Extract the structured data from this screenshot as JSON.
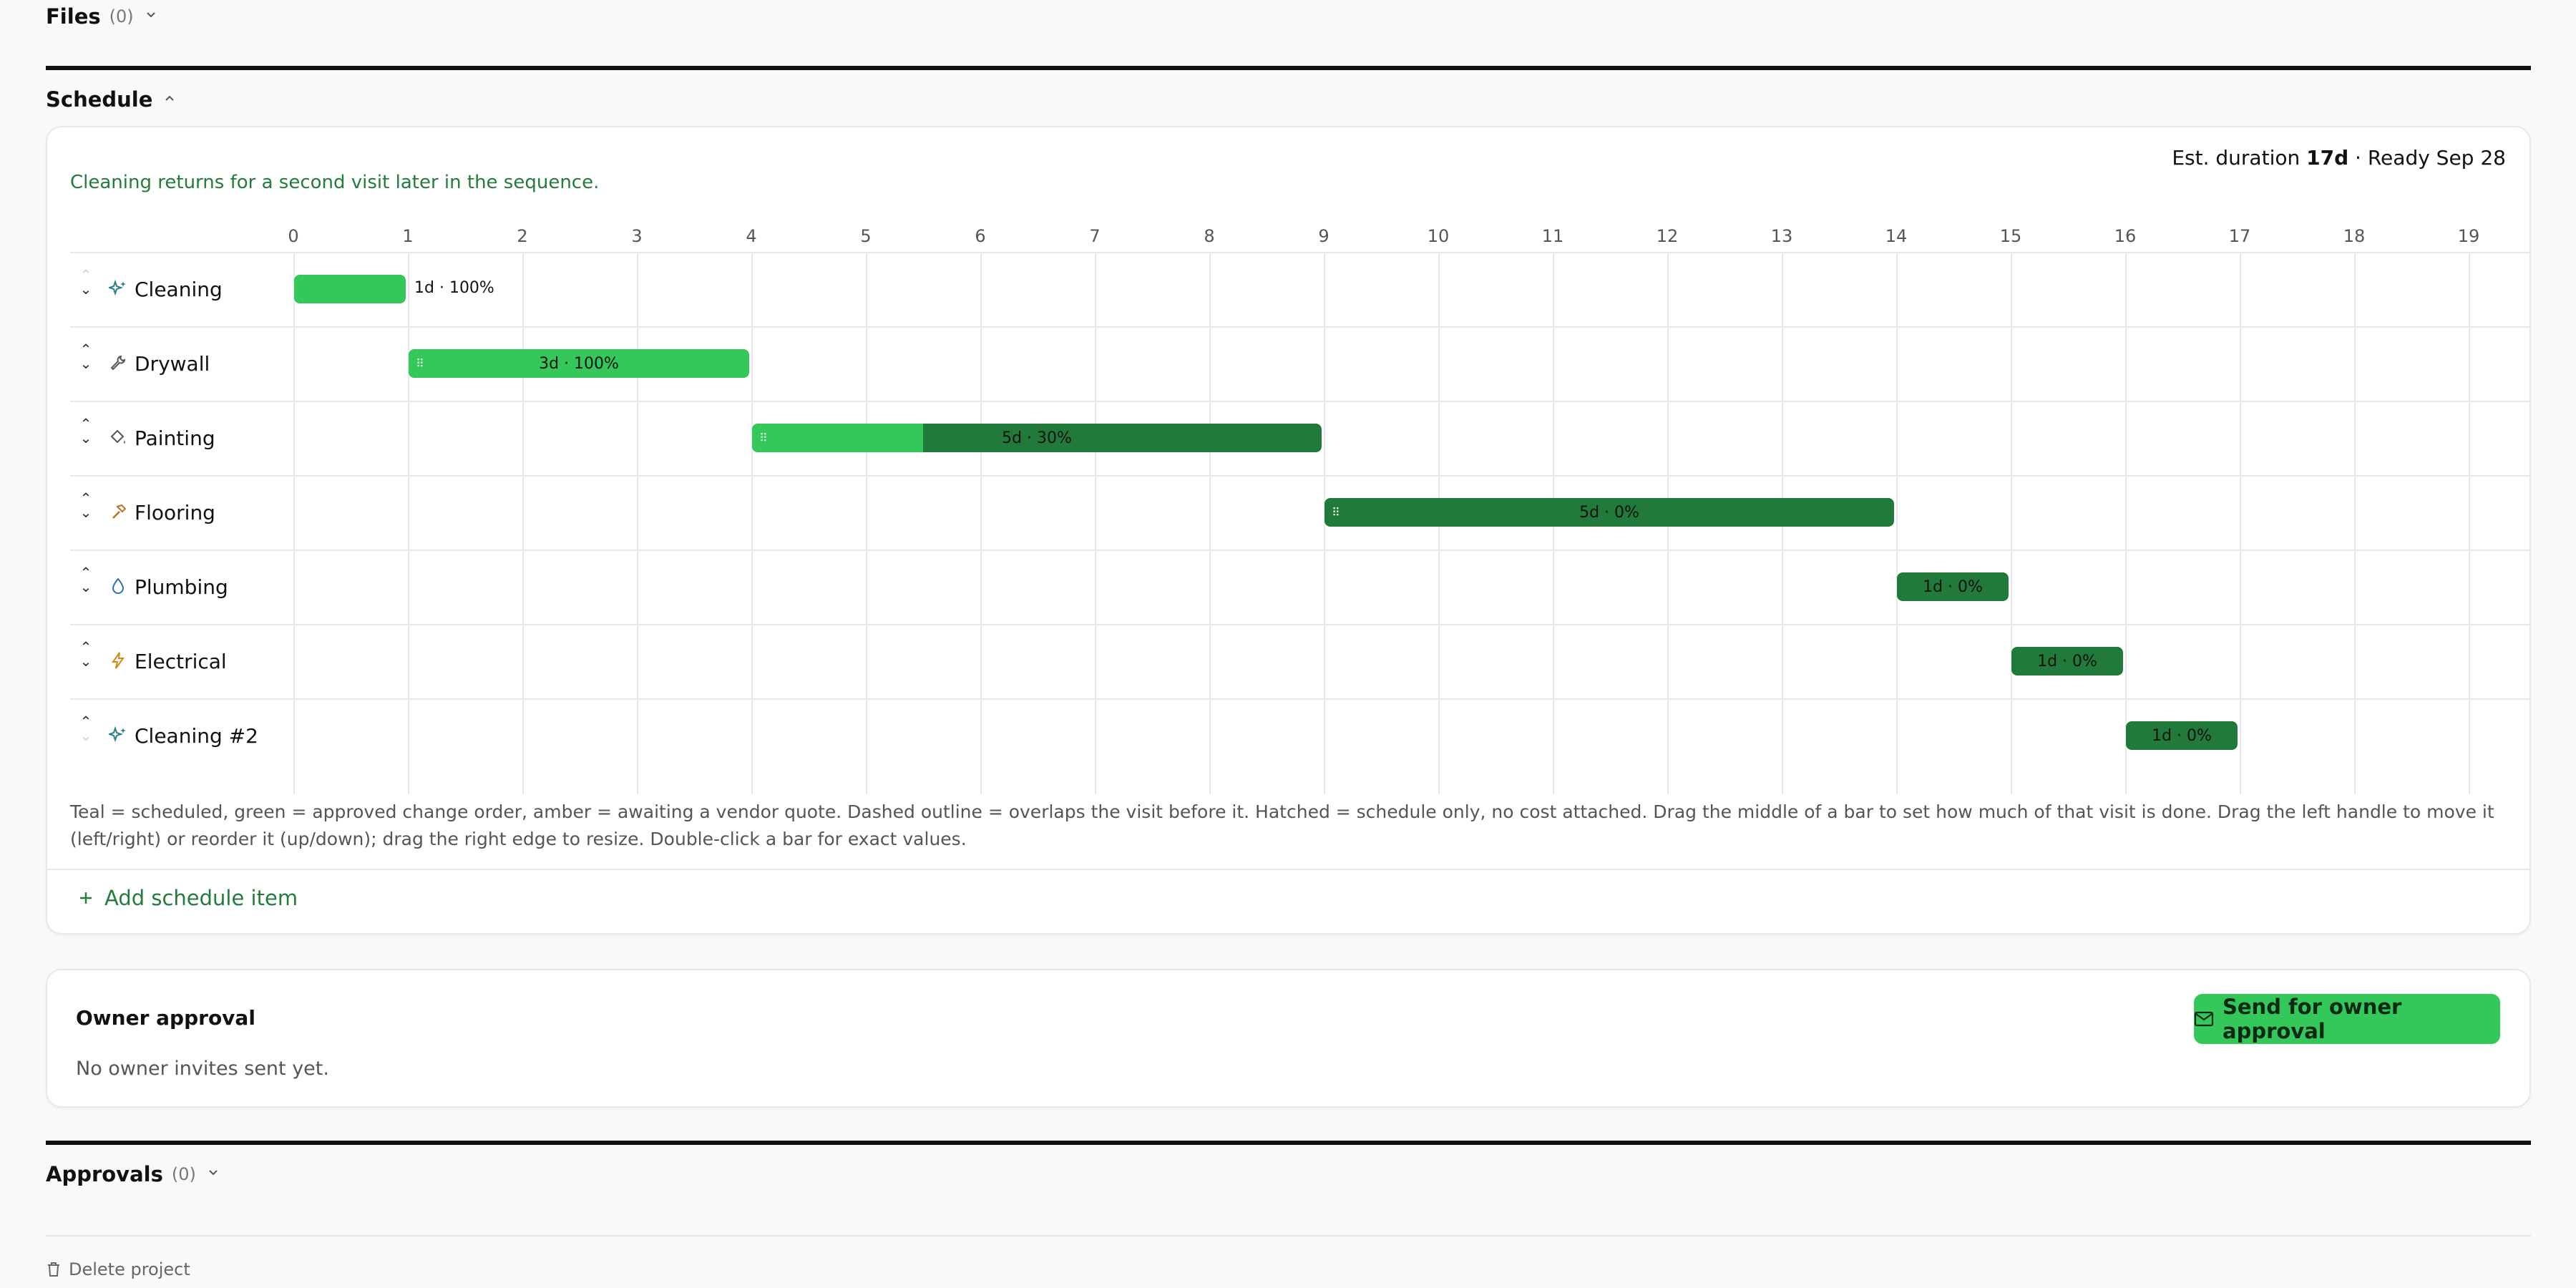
{
  "files": {
    "title": "Files",
    "count": "(0)"
  },
  "schedule": {
    "title": "Schedule",
    "note": "Cleaning returns for a second visit later in the sequence.",
    "est_prefix": "Est. duration ",
    "est_duration": "17d",
    "est_suffix": " · Ready Sep 28",
    "ticks": [
      "0",
      "1",
      "2",
      "3",
      "4",
      "5",
      "6",
      "7",
      "8",
      "9",
      "10",
      "11",
      "12",
      "13",
      "14",
      "15",
      "16",
      "17",
      "18",
      "19"
    ],
    "rows": [
      {
        "label": "Cleaning",
        "icon": "sparkles-icon",
        "start": 0,
        "duration": 1,
        "progress": 100,
        "bar_label": "1d · 100%",
        "label_outside": true
      },
      {
        "label": "Drywall",
        "icon": "wrench-icon",
        "start": 1,
        "duration": 3,
        "progress": 100,
        "bar_label": "3d · 100%",
        "label_outside": false
      },
      {
        "label": "Painting",
        "icon": "paint-bucket-icon",
        "start": 4,
        "duration": 5,
        "progress": 30,
        "bar_label": "5d · 30%",
        "label_outside": false
      },
      {
        "label": "Flooring",
        "icon": "hammer-icon",
        "start": 9,
        "duration": 5,
        "progress": 0,
        "bar_label": "5d · 0%",
        "label_outside": false
      },
      {
        "label": "Plumbing",
        "icon": "droplet-icon",
        "start": 14,
        "duration": 1,
        "progress": 0,
        "bar_label": "1d · 0%",
        "label_outside": false
      },
      {
        "label": "Electrical",
        "icon": "bolt-icon",
        "start": 15,
        "duration": 1,
        "progress": 0,
        "bar_label": "1d · 0%",
        "label_outside": false
      },
      {
        "label": "Cleaning #2",
        "icon": "sparkles-icon",
        "start": 16,
        "duration": 1,
        "progress": 0,
        "bar_label": "1d · 0%",
        "label_outside": false
      }
    ],
    "legend": "Teal = scheduled, green = approved change order, amber = awaiting a vendor quote. Dashed outline = overlaps the visit before it. Hatched = schedule only, no cost attached. Drag the middle of a bar to set how much of that visit is done. Drag the left handle to move it (left/right) or reorder it (up/down); drag the right edge to resize. Double-click a bar for exact values.",
    "add_label": "Add schedule item",
    "colors": {
      "done": "#34c759",
      "remaining": "#217a3a",
      "accent": "#237c3b"
    }
  },
  "owner_approval": {
    "title": "Owner approval",
    "status": "No owner invites sent yet.",
    "send_button": "Send for owner approval"
  },
  "approvals": {
    "title": "Approvals",
    "count": "(0)"
  },
  "delete_label": "Delete project"
}
